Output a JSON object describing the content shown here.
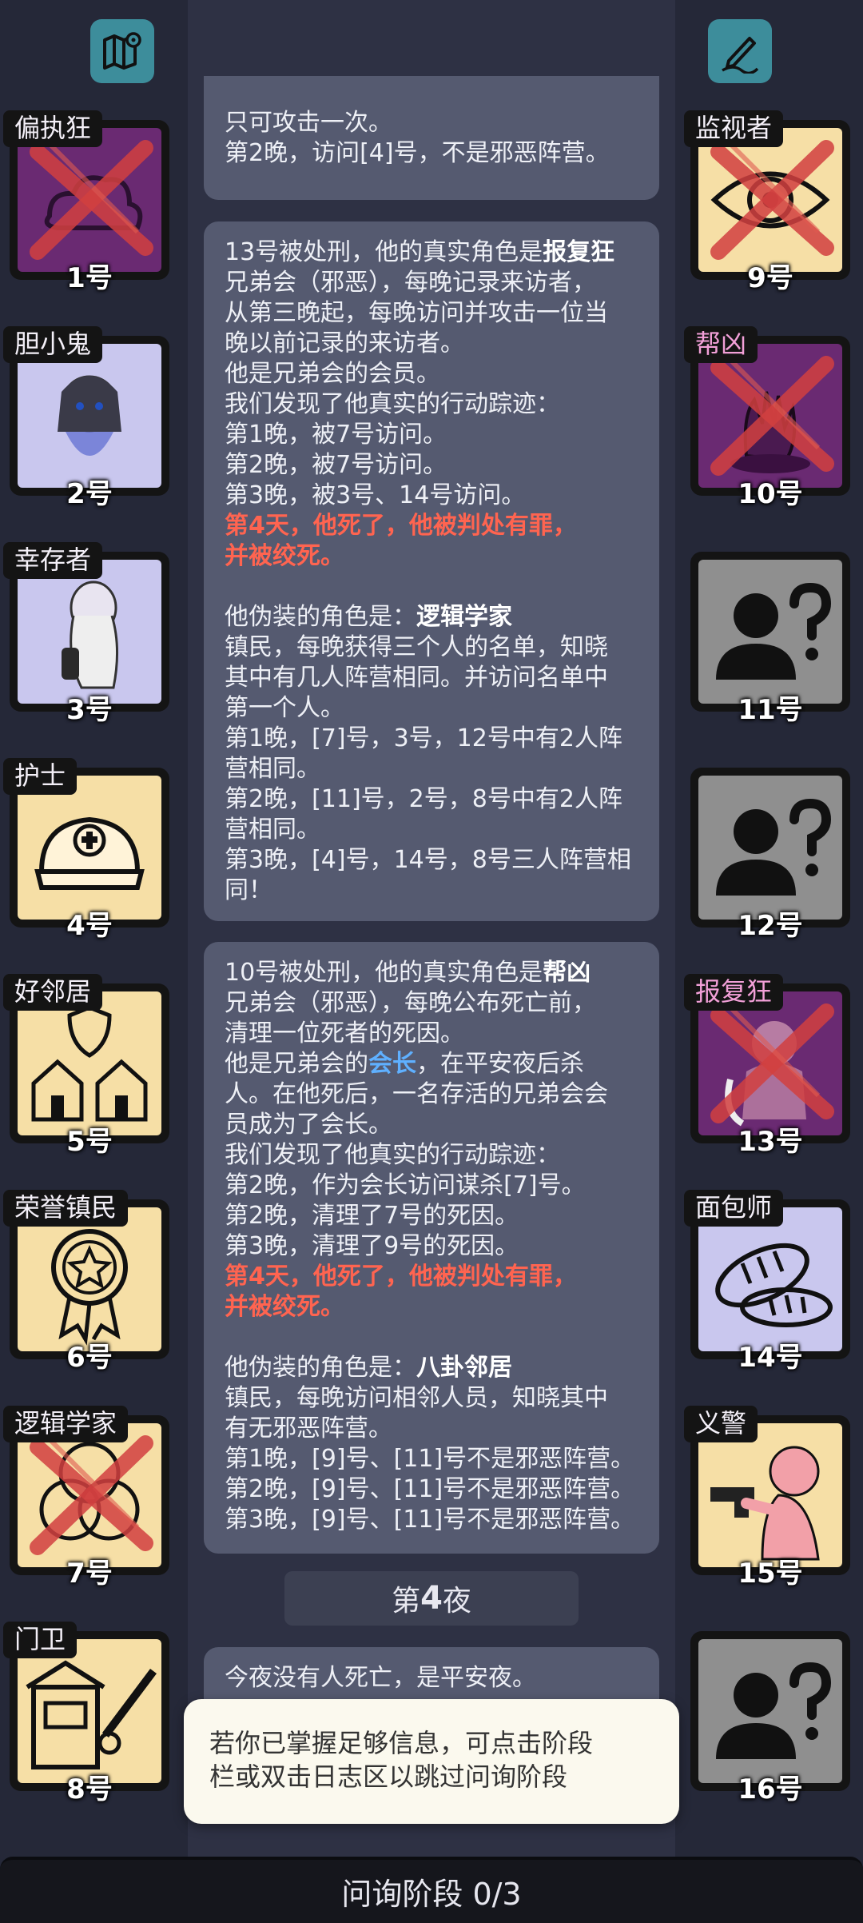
{
  "top_buttons": {
    "left_icon": "map-icon",
    "right_icon": "notes-pen-icon",
    "color": "#3d8d9b"
  },
  "players_left": [
    {
      "role": "偏执狂",
      "number": "1号",
      "dead": true,
      "bg": "#6a2a72",
      "icon": "cloud-icon",
      "evil": false
    },
    {
      "role": "胆小鬼",
      "number": "2号",
      "dead": false,
      "bg": "#c9c7ee",
      "icon": "ghost-girl-icon",
      "evil": false
    },
    {
      "role": "幸存者",
      "number": "3号",
      "dead": false,
      "bg": "#c9c7ee",
      "icon": "crouching-figure-icon",
      "evil": false
    },
    {
      "role": "护士",
      "number": "4号",
      "dead": false,
      "bg": "#f6dfa6",
      "icon": "nurse-cap-icon",
      "evil": false
    },
    {
      "role": "好邻居",
      "number": "5号",
      "dead": false,
      "bg": "#f6dfa6",
      "icon": "houses-shield-icon",
      "evil": false
    },
    {
      "role": "荣誉镇民",
      "number": "6号",
      "dead": false,
      "bg": "#f6dfa6",
      "icon": "medal-star-icon",
      "evil": false
    },
    {
      "role": "逻辑学家",
      "number": "7号",
      "dead": true,
      "bg": "#f6dfa6",
      "icon": "venn-diagram-icon",
      "evil": false
    },
    {
      "role": "门卫",
      "number": "8号",
      "dead": false,
      "bg": "#f6dfa6",
      "icon": "guard-booth-icon",
      "evil": false
    }
  ],
  "players_right": [
    {
      "role": "监视者",
      "number": "9号",
      "dead": true,
      "bg": "#f6dfa6",
      "icon": "eye-icon",
      "evil": false
    },
    {
      "role": "帮凶",
      "number": "10号",
      "dead": true,
      "bg": "#6a2a72",
      "icon": "bloody-hand-icon",
      "evil": true
    },
    {
      "role": "",
      "number": "11号",
      "dead": false,
      "bg": "#8f8f8f",
      "icon": "unknown-person-icon",
      "evil": false
    },
    {
      "role": "",
      "number": "12号",
      "dead": false,
      "bg": "#8f8f8f",
      "icon": "unknown-person-icon",
      "evil": false
    },
    {
      "role": "报复狂",
      "number": "13号",
      "dead": true,
      "bg": "#6a2a72",
      "icon": "angry-figure-icon",
      "evil": true
    },
    {
      "role": "面包师",
      "number": "14号",
      "dead": false,
      "bg": "#c9c7ee",
      "icon": "bread-icon",
      "evil": false
    },
    {
      "role": "义警",
      "number": "15号",
      "dead": false,
      "bg": "#f6dfa6",
      "icon": "gunman-icon",
      "evil": false
    },
    {
      "role": "",
      "number": "16号",
      "dead": false,
      "bg": "#8f8f8f",
      "icon": "unknown-person-icon",
      "evil": false
    }
  ],
  "log": {
    "bubble1": {
      "lines": [
        "只可攻击一次。",
        "第2晚，访问[4]号，不是邪恶阵营。"
      ]
    },
    "bubble2": {
      "l1a": "13号被处刑，他的真实角色是",
      "l1b": "报复狂",
      "lines_a": [
        "兄弟会（邪恶），每晚记录来访者，",
        "从第三晚起，每晚访问并攻击一位当",
        "晚以前记录的来访者。",
        "他是兄弟会的会员。",
        "我们发现了他真实的行动踪迹：",
        "第1晚，被7号访问。",
        "第2晚，被7号访问。",
        "第3晚，被3号、14号访问。"
      ],
      "red1": "第4天，他死了，他被判处有罪，",
      "red2": "并被绞死。",
      "fake_a": "他伪装的角色是：",
      "fake_b": "逻辑学家",
      "lines_b": [
        "镇民，每晚获得三个人的名单，知晓",
        "其中有几人阵营相同。并访问名单中",
        "第一个人。",
        "第1晚，[7]号，3号，12号中有2人阵",
        "营相同。",
        "第2晚，[11]号，2号，8号中有2人阵",
        "营相同。",
        "第3晚，[4]号，14号，8号三人阵营相",
        "同！"
      ]
    },
    "bubble3": {
      "l1a": "10号被处刑，他的真实角色是",
      "l1b": "帮凶",
      "lines_a": [
        "兄弟会（邪恶），每晚公布死亡前，",
        "清理一位死者的死因。"
      ],
      "mid_a": "他是兄弟会的",
      "mid_b": "会长",
      "mid_c": "，在平安夜后杀",
      "lines_b": [
        "人。在他死后，一名存活的兄弟会会",
        "员成为了会长。",
        "我们发现了他真实的行动踪迹：",
        "第2晚，作为会长访问谋杀[7]号。",
        "第2晚，清理了7号的死因。",
        "第3晚，清理了9号的死因。"
      ],
      "red1": "第4天，他死了，他被判处有罪，",
      "red2": "并被绞死。",
      "fake_a": "他伪装的角色是：",
      "fake_b": "八卦邻居",
      "lines_c": [
        "镇民，每晚访问相邻人员，知晓其中",
        "有无邪恶阵营。",
        "第1晚，[9]号、[11]号不是邪恶阵营。",
        "第2晚，[9]号、[11]号不是邪恶阵营。",
        "第3晚，[9]号、[11]号不是邪恶阵营。"
      ]
    },
    "night_pre": "第",
    "night_num": "4",
    "night_post": "夜",
    "bubble4": "今夜没有人死亡，是平安夜。"
  },
  "hint": {
    "line1": "若你已掌握足够信息，可点击阶段",
    "line2": "栏或双击日志区以跳过问询阶段"
  },
  "phase": {
    "label": "问询阶段 0/3"
  }
}
